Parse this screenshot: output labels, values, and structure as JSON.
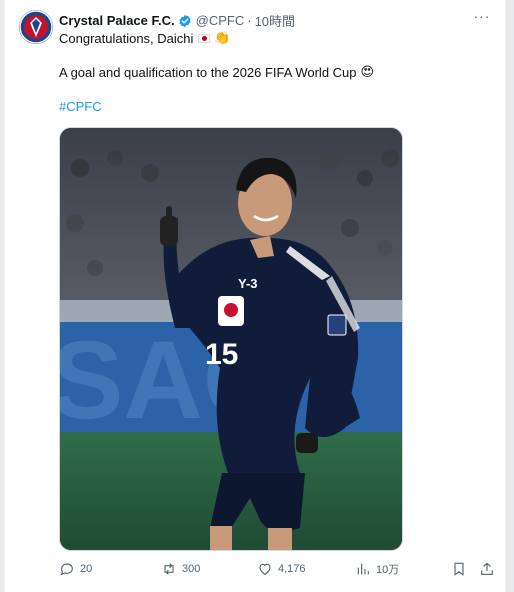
{
  "tweet": {
    "author_name": "Crystal Palace F.C.",
    "handle": "@CPFC",
    "separator": "·",
    "time": "10時間",
    "line1_text": "Congratulations, Daichi",
    "line1_emojis": [
      "flag-japan",
      "clapping-hands"
    ],
    "line2_text": "A goal and qualification to the 2026 FIFA World Cup",
    "line2_emoji": "heart-eyes-face",
    "hashtag": "#CPFC",
    "more_icon": "ellipsis",
    "jersey_number": "15",
    "sponsor_logo": "Y-3"
  },
  "actions": {
    "replies": "20",
    "reposts": "300",
    "likes": "4,176",
    "views": "10万"
  },
  "colors": {
    "accent": "#1d9bf0",
    "text": "#0f1419",
    "muted": "#536471",
    "verified": "#1d9bf0",
    "jersey": "#101c3a"
  }
}
